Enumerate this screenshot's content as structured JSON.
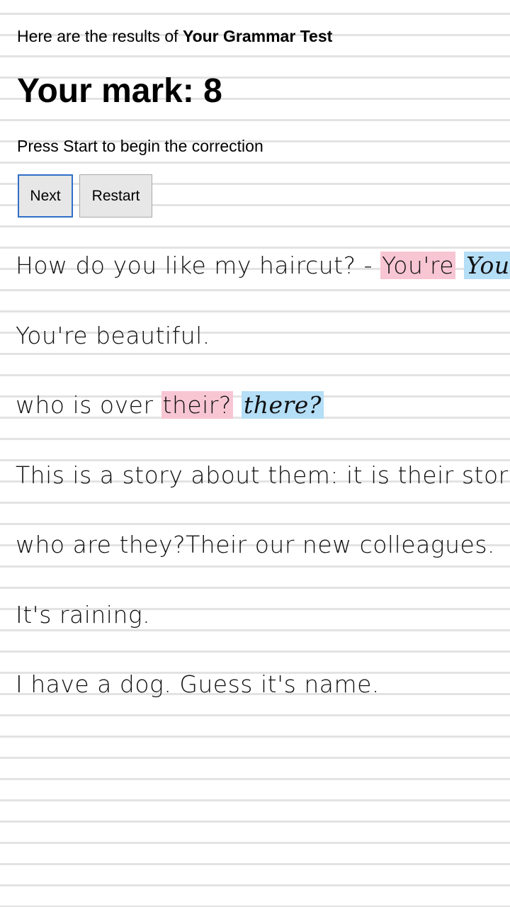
{
  "header": {
    "intro_prefix": "Here are the results of ",
    "test_name": "Your Grammar Test",
    "mark_label": "Your mark: 8",
    "instruction": "Press Start to begin the correction"
  },
  "buttons": {
    "next_label": "Next",
    "restart_label": "Restart"
  },
  "sentences": [
    {
      "before": "How do you like my haircut? - ",
      "wrong": "You're",
      "correction": "Your",
      "after": ""
    },
    {
      "before": "You're beautiful.",
      "wrong": "",
      "correction": "",
      "after": ""
    },
    {
      "before": "who is over ",
      "wrong": "their?",
      "correction": "there?",
      "after": ""
    },
    {
      "before": "This is a story about them: it is their story.",
      "wrong": "",
      "correction": "",
      "after": ""
    },
    {
      "before": "who are they?Their our new colleagues.",
      "wrong": "",
      "correction": "",
      "after": ""
    },
    {
      "before": "It's raining.",
      "wrong": "",
      "correction": "",
      "after": ""
    },
    {
      "before": "I have a dog. Guess it's name.",
      "wrong": "",
      "correction": "",
      "after": ""
    }
  ],
  "colors": {
    "wrong_highlight": "#f8c6d3",
    "correction_highlight": "#b5def7",
    "next_button_border": "#2f6fc6"
  }
}
